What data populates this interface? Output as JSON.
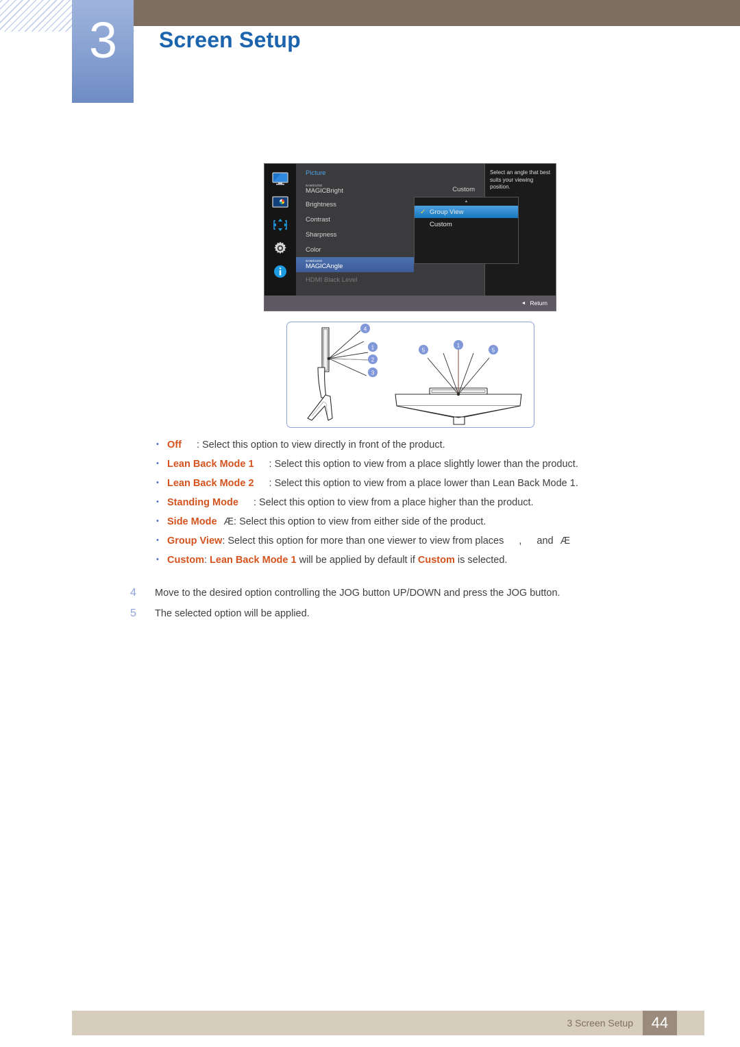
{
  "header": {
    "chapter_number": "3",
    "chapter_title": "Screen Setup"
  },
  "osd": {
    "menu_title": "Picture",
    "sidebar_icons": [
      "display-icon",
      "picture-icon",
      "move-arrows-icon",
      "gear-icon",
      "info-icon"
    ],
    "rows": [
      {
        "prefix_small": "SAMSUNG",
        "prefix_big": "MAGIC",
        "label": "Bright",
        "value": "Custom"
      },
      {
        "label": "Brightness",
        "value": ""
      },
      {
        "label": "Contrast",
        "value": ""
      },
      {
        "label": "Sharpness",
        "value": ""
      },
      {
        "label": "Color",
        "value": ""
      },
      {
        "prefix_small": "SAMSUNG",
        "prefix_big": "MAGIC",
        "label": "Angle",
        "value": ""
      },
      {
        "label": "HDMI Black Level",
        "value": ""
      }
    ],
    "popup": {
      "up_arrow": "▲",
      "items": [
        {
          "label": "Group View",
          "checked": true
        },
        {
          "label": "Custom",
          "checked": false
        }
      ]
    },
    "help_text": "Select an angle that best suits your viewing position.",
    "footer": {
      "back_arrow": "◄",
      "return_label": "Return"
    }
  },
  "diagram": {
    "left_view_callouts": [
      "4",
      "1",
      "2",
      "3"
    ],
    "right_view_callouts": [
      "5",
      "1",
      "5"
    ]
  },
  "bullets": [
    {
      "bullet": "•",
      "term": "Off",
      "glyph": "",
      "rest": ": Select this option to view directly in front of the product."
    },
    {
      "bullet": "•",
      "term": "Lean Back Mode 1",
      "glyph": "",
      "rest": ": Select this option to view from a place slightly lower than the product."
    },
    {
      "bullet": "•",
      "term": "Lean Back Mode 2",
      "glyph": "",
      "rest": ": Select this option to view from a place lower than Lean Back Mode 1."
    },
    {
      "bullet": "•",
      "term": "Standing Mode",
      "glyph": "",
      "rest": ": Select this option to view from a place higher than the product."
    },
    {
      "bullet": "•",
      "term": "Side Mode",
      "glyph": "Æ",
      "rest": ": Select this option to view from either side of the product."
    },
    {
      "bullet": "•",
      "term": "Group View",
      "glyph": "",
      "rest": ": Select this option for more than one viewer to view from places",
      "tail_a": ",",
      "tail_and": "and",
      "tail_glyph": "Æ"
    },
    {
      "bullet": "•",
      "term": "Custom",
      "glyph": "",
      "rest": ":",
      "term2": "Lean Back Mode 1",
      "rest2": " will be applied by default if ",
      "term3": "Custom",
      "rest3": " is selected."
    }
  ],
  "steps": [
    {
      "num": "4",
      "text": "Move to the desired option controlling the JOG button UP/DOWN and press the JOG button."
    },
    {
      "num": "5",
      "text": "The selected option will be applied."
    }
  ],
  "footer": {
    "section": "3 Screen Setup",
    "page": "44"
  }
}
